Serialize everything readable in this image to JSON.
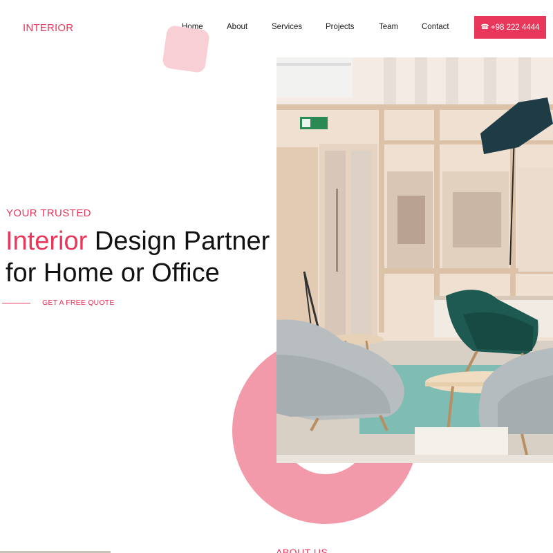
{
  "brand": {
    "logo": "INTERIOR"
  },
  "nav": {
    "items": [
      {
        "label": "Home"
      },
      {
        "label": "About"
      },
      {
        "label": "Services"
      },
      {
        "label": "Projects"
      },
      {
        "label": "Team"
      },
      {
        "label": "Contact"
      }
    ],
    "phone": {
      "icon": "phone-icon",
      "label": "+98 222 4444"
    }
  },
  "hero": {
    "eyebrow": "YOUR TRUSTED",
    "headline_accent": "Interior",
    "headline_line1_rest": " Design Partner",
    "headline_line2": "for Home or Office",
    "cta": "GET A FREE QUOTE",
    "image": {
      "subject": "office lounge with grey and green armchairs"
    }
  },
  "next_section": {
    "title": "ABOUT US"
  },
  "colors": {
    "accent": "#e8375a",
    "accent_light": "#f9cfd6",
    "ring": "#f39aaa",
    "text": "#111111"
  }
}
